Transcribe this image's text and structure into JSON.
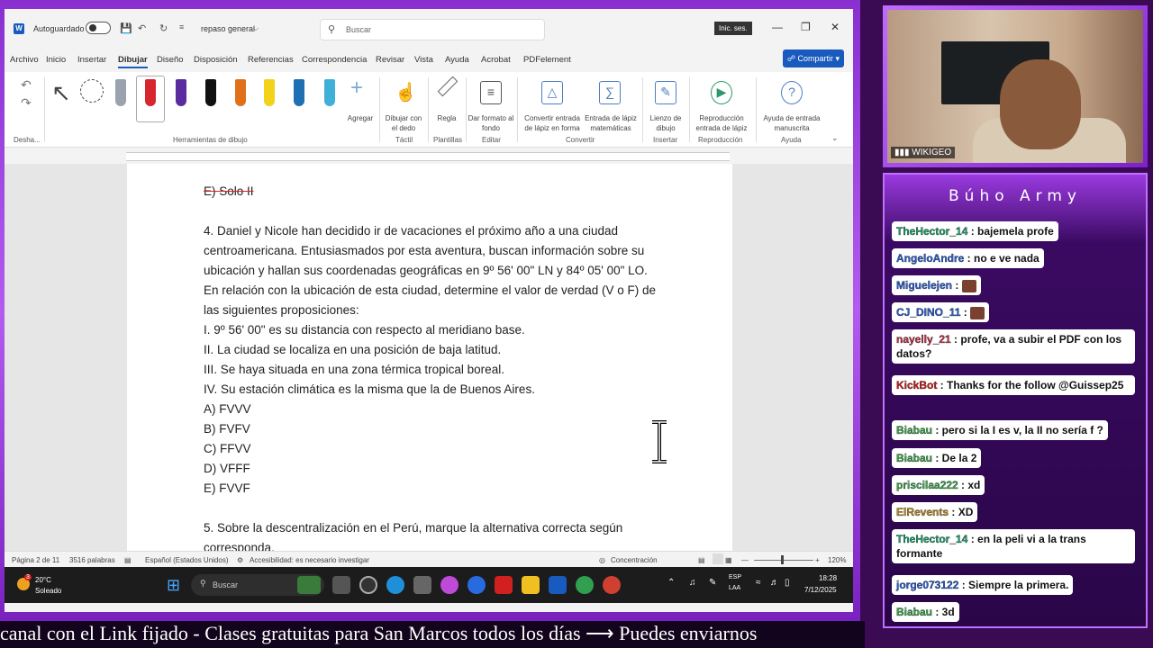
{
  "window": {
    "autosave_label": "Autoguardado",
    "doc_name": "repaso general",
    "search_placeholder": "Buscar",
    "signin_label": "Inic. ses."
  },
  "menu": {
    "items": [
      "Archivo",
      "Inicio",
      "Insertar",
      "Dibujar",
      "Diseño",
      "Disposición",
      "Referencias",
      "Correspondencia",
      "Revisar",
      "Vista",
      "Ayuda",
      "Acrobat",
      "PDFelement"
    ],
    "active": "Dibujar",
    "share_label": "Compartir"
  },
  "ribbon": {
    "undo_group": "Desha...",
    "drawing_tools_group": "Herramientas de dibujo",
    "add_label": "Agregar",
    "draw_with_finger": "Dibujar con el dedo",
    "ruler": "Regla",
    "format_background": "Dar formato al fondo",
    "convert_ink": "Convertir entrada de lápiz en forma",
    "math_ink": "Entrada de lápiz matemáticas",
    "canvas": "Lienzo de dibujo",
    "replay_ink": "Reproducción entrada de lápiz",
    "ink_help": "Ayuda de entrada manuscrita",
    "group_tactil": "Táctil",
    "group_plantillas": "Plantillas",
    "group_editar": "Editar",
    "group_convertir": "Convertir",
    "group_insertar": "Insertar",
    "group_reproduccion": "Reproducción",
    "group_ayuda": "Ayuda",
    "pen_colors": [
      "#9aa3ad",
      "#d8262e",
      "#5a2ca0",
      "#111111",
      "#e0701a",
      "#f2d21b",
      "#1f6fb5",
      "#3fb0d8"
    ]
  },
  "document": {
    "lines": [
      "E) Solo II",
      "4. Daniel y Nicole han decidido ir de vacaciones el próximo año a una ciudad",
      "centroamericana. Entusiasmados por esta aventura, buscan información sobre su",
      "ubicación y hallan sus coordenadas geográficas en 9º 56' 00\" LN y 84º 05' 00\" LO.",
      "En relación con la ubicación de esta ciudad, determine el valor de verdad (V o F) de",
      "las siguientes proposiciones:",
      " I. 9º 56' 00\" es su distancia con respecto al meridiano base.",
      "II. La ciudad se localiza en una posición de baja latitud.",
      "III. Se haya situada en una zona térmica tropical boreal.",
      "IV. Su estación climática es la misma que la de Buenos Aires.",
      "A) FVVV",
      "B) FVFV",
      "C) FFVV",
      "D) VFFF",
      "E) FVVF",
      "5. Sobre la descentralización en el Perú, marque la alternativa correcta según",
      "corresponda."
    ]
  },
  "status": {
    "page": "Página 2 de 11",
    "words": "3516 palabras",
    "language": "Español (Estados Unidos)",
    "accessibility": "Accesibilidad: es necesario investigar",
    "focus": "Concentración",
    "zoom": "120%"
  },
  "taskbar": {
    "temp": "20°C",
    "weather": "Soleado",
    "search": "Buscar",
    "lang1": "ESP",
    "lang2": "LAA",
    "time": "18:28",
    "date": "7/12/2025",
    "weather_badge": "3"
  },
  "stream": {
    "ticker": "canal con el Link fijado  -  Clases gratuitas para San Marcos todos los días  ⟶  Puedes enviarnos",
    "cam_badge": "WIKIGEO",
    "chat_title": "Búho Army",
    "messages": [
      {
        "user": "TheHector_14",
        "color": "#1aa36a",
        "text": ": bajemela profe"
      },
      {
        "user": "AngeloAndre",
        "color": "#2a5fd0",
        "text": ": no e ve nada"
      },
      {
        "user": "Miguelejen",
        "color": "#2a5fd0",
        "text": ": ",
        "sticker": true
      },
      {
        "user": "CJ_DINO_11",
        "color": "#2a5fd0",
        "text": ": ",
        "sticker": true
      },
      {
        "user": "nayelly_21",
        "color": "#c0304a",
        "text": ": profe, va a subir el PDF con los datos?"
      },
      {
        "user": "KickBot",
        "color": "#d01a1a",
        "text": ": Thanks for the follow @Guissep25"
      },
      {
        "user": "Biabau",
        "color": "#3aa84a",
        "text": ": pero si la I es v, la II no sería f ?"
      },
      {
        "user": "Biabau",
        "color": "#3aa84a",
        "text": ": De la 2"
      },
      {
        "user": "priscilaa222",
        "color": "#3aa84a",
        "text": ": xd"
      },
      {
        "user": "ElRevents",
        "color": "#b88a20",
        "text": ": XD"
      },
      {
        "user": "TheHector_14",
        "color": "#1aa36a",
        "text": ": en la peli vi a la trans formante"
      },
      {
        "user": "jorge073122",
        "color": "#2a5fd0",
        "text": ": Siempre la primera."
      },
      {
        "user": "Biabau",
        "color": "#3aa84a",
        "text": ": 3d"
      }
    ]
  }
}
